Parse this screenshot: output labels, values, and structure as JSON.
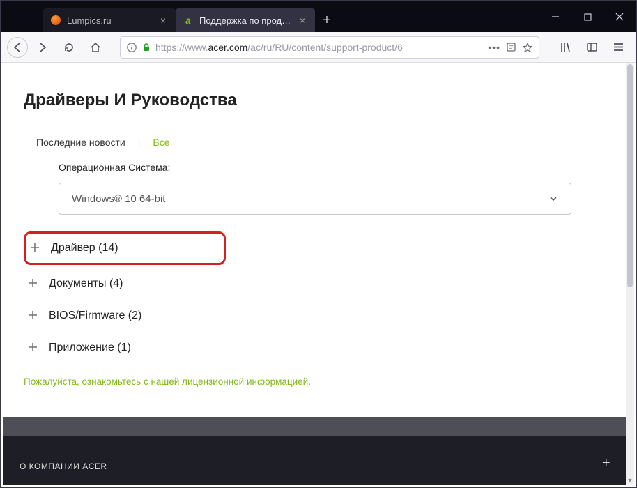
{
  "window": {
    "tabs": [
      {
        "label": "Lumpics.ru",
        "favicon": "orange-circle",
        "active": false
      },
      {
        "label": "Поддержка по продуктам",
        "favicon": "acer",
        "active": true
      }
    ]
  },
  "toolbar": {
    "url_prefix": "https://",
    "url_host": "www.",
    "url_domain": "acer.com",
    "url_path": "/ac/ru/RU/content/support-product/6"
  },
  "page": {
    "title": "Драйверы И Руководства",
    "filter_latest": "Последние новости",
    "filter_all": "Все",
    "os_label": "Операционная Система:",
    "os_value": "Windows® 10 64-bit",
    "accordion": [
      {
        "label": "Драйвер (14)",
        "highlight": true
      },
      {
        "label": "Документы (4)",
        "highlight": false
      },
      {
        "label": "BIOS/Firmware (2)",
        "highlight": false
      },
      {
        "label": "Приложение (1)",
        "highlight": false
      }
    ],
    "license_text": "Пожалуйста, ознакомьтесь с нашей лицензионной информацией."
  },
  "footer": {
    "about": "О КОМПАНИИ ACER"
  }
}
